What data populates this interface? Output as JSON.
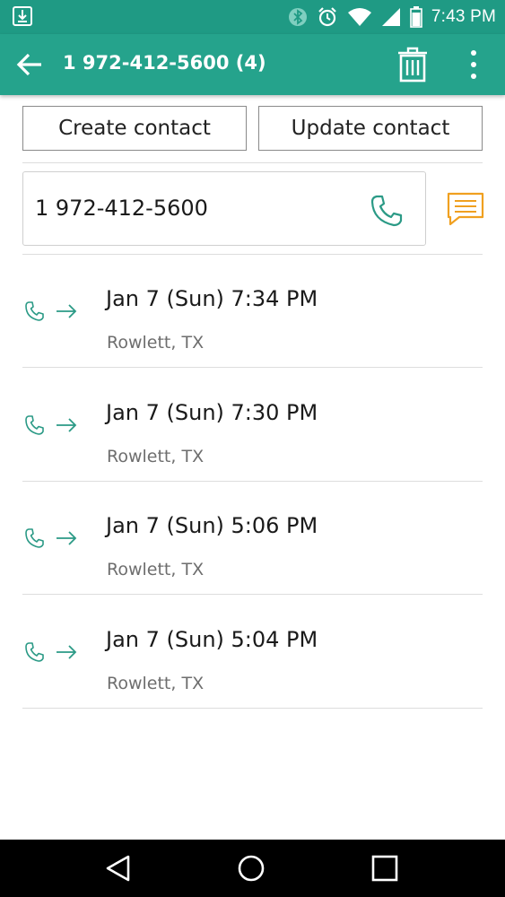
{
  "status_bar": {
    "time": "7:43 PM",
    "icons": [
      "download-icon",
      "bluetooth-icon",
      "alarm-icon",
      "wifi-icon",
      "cell-signal-icon",
      "battery-icon"
    ]
  },
  "toolbar": {
    "title": "1 972-412-5600 (4)",
    "icons": [
      "back-arrow-icon",
      "trash-icon",
      "overflow-menu-icon"
    ]
  },
  "actions": {
    "create_contact": "Create contact",
    "update_contact": "Update contact"
  },
  "number_card": {
    "number": "1 972-412-5600"
  },
  "call_log": [
    {
      "time": "Jan 7 (Sun) 7:34 PM",
      "location": "Rowlett, TX",
      "type": "outgoing"
    },
    {
      "time": "Jan 7 (Sun) 7:30 PM",
      "location": "Rowlett, TX",
      "type": "outgoing"
    },
    {
      "time": "Jan 7 (Sun) 5:06 PM",
      "location": "Rowlett, TX",
      "type": "outgoing"
    },
    {
      "time": "Jan 7 (Sun) 5:04 PM",
      "location": "Rowlett, TX",
      "type": "outgoing"
    }
  ],
  "nav_bar": {
    "icons": [
      "back-triangle-icon",
      "home-circle-icon",
      "recents-square-icon"
    ]
  },
  "colors": {
    "accent": "#25a38c",
    "status_bar": "#1f9a84",
    "call_icon": "#2b9a86",
    "message_icon": "#f0a020"
  }
}
